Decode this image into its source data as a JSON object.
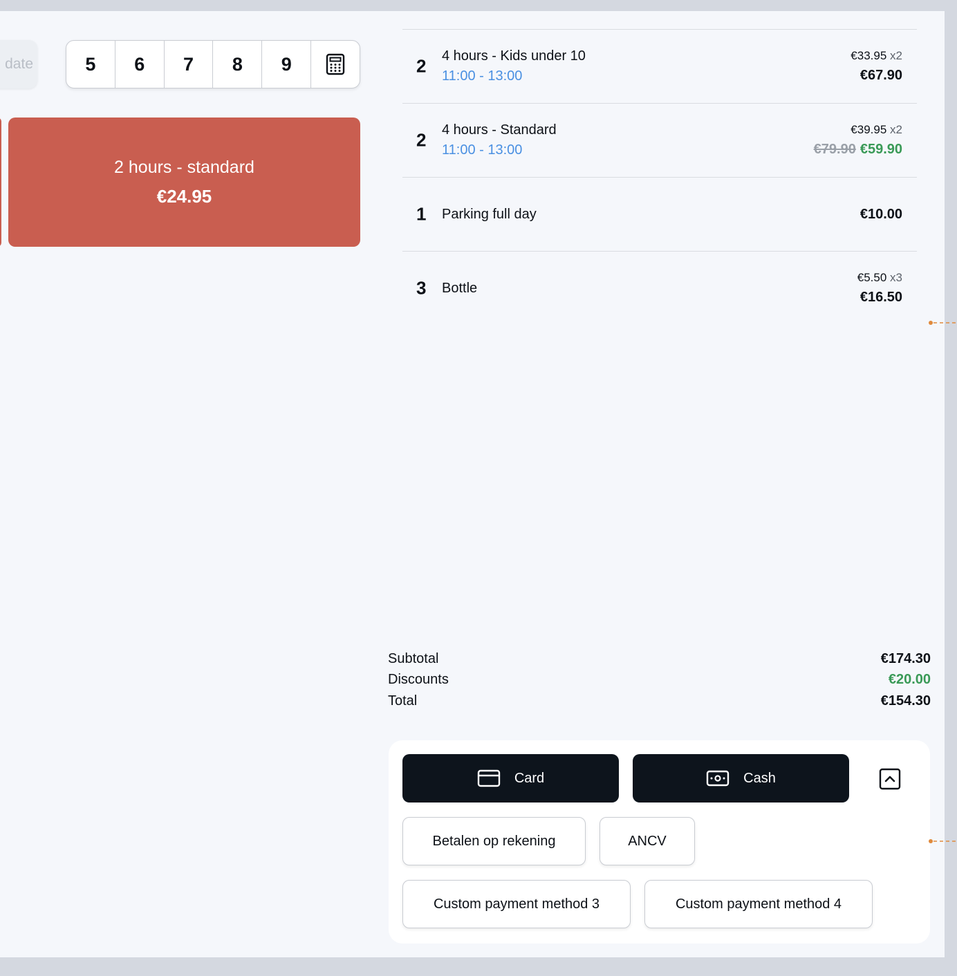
{
  "date_tab": {
    "label": "date"
  },
  "numpad": {
    "keys": [
      "5",
      "6",
      "7",
      "8",
      "9"
    ],
    "calculator_icon": "calculator-icon"
  },
  "product_tile": {
    "name": "2 hours - standard",
    "price": "€24.95",
    "color": "#c95e50"
  },
  "cart": {
    "items": [
      {
        "qty": "2",
        "name": "4 hours - Kids under 10",
        "time": "11:00 - 13:00",
        "unit_price": "€33.95",
        "multiplier": "x2",
        "total": "€67.90"
      },
      {
        "qty": "2",
        "name": "4 hours - Standard",
        "time": "11:00 - 13:00",
        "unit_price": "€39.95",
        "multiplier": "x2",
        "original_total": "€79.90",
        "total": "€59.90"
      },
      {
        "qty": "1",
        "name": "Parking full day",
        "total": "€10.00"
      },
      {
        "qty": "3",
        "name": "Bottle",
        "unit_price": "€5.50",
        "multiplier": "x3",
        "total": "€16.50"
      }
    ]
  },
  "totals": {
    "subtotal_label": "Subtotal",
    "subtotal": "€174.30",
    "discounts_label": "Discounts",
    "discounts": "€20.00",
    "total_label": "Total",
    "total": "€154.30"
  },
  "payment": {
    "card_label": "Card",
    "cash_label": "Cash",
    "methods": [
      "Betalen op rekening",
      "ANCV",
      "Custom payment method 3",
      "Custom payment method 4"
    ]
  },
  "colors": {
    "accent_red": "#c95e50",
    "time_blue": "#4a90e2",
    "discount_green": "#3a9a57",
    "dark_button": "#0d141c",
    "annotation_orange": "#e08a3c"
  }
}
